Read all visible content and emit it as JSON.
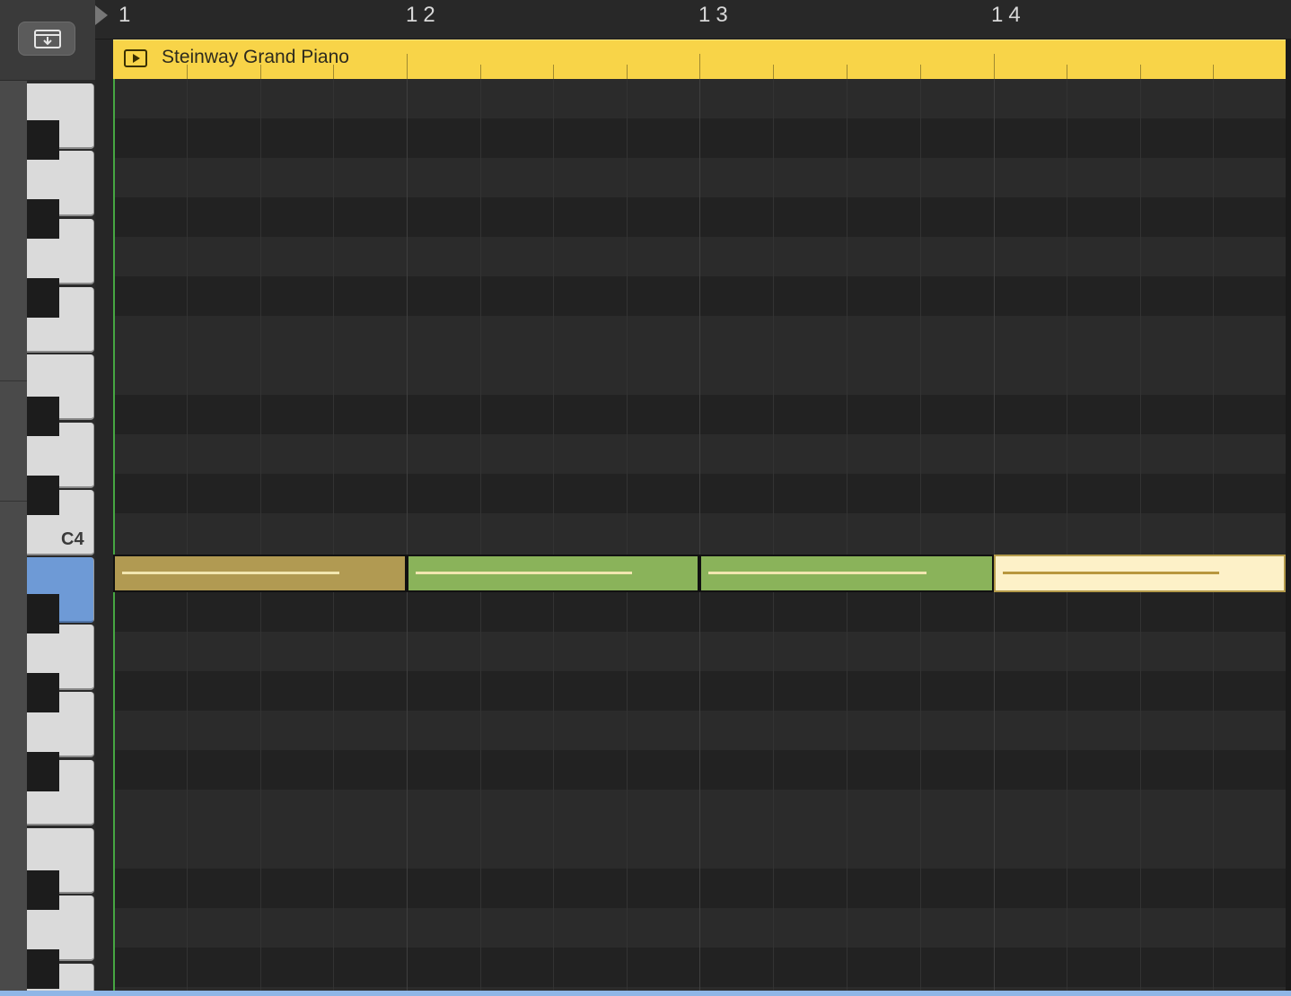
{
  "catch_button": {
    "icon": "catch-playhead-icon"
  },
  "ruler": {
    "bars": [
      "1",
      "12",
      "13",
      "14"
    ]
  },
  "region": {
    "name": "Steinway Grand Piano",
    "color": "#f8d448"
  },
  "keyboard": {
    "label": "C4",
    "highlight_color": "#6e9ad6"
  },
  "notes": [
    {
      "pitch": "C4",
      "bar": 11,
      "color": "#b19a52",
      "selected": false
    },
    {
      "pitch": "C4",
      "bar": 12,
      "color": "#8ab35a",
      "selected": false
    },
    {
      "pitch": "C4",
      "bar": 13,
      "color": "#8ab35a",
      "selected": false
    },
    {
      "pitch": "C4",
      "bar": 14,
      "color": "#fdf1c8",
      "selected": true
    }
  ],
  "colors": {
    "playhead": "#46a642",
    "background": "#1e1e1e"
  }
}
